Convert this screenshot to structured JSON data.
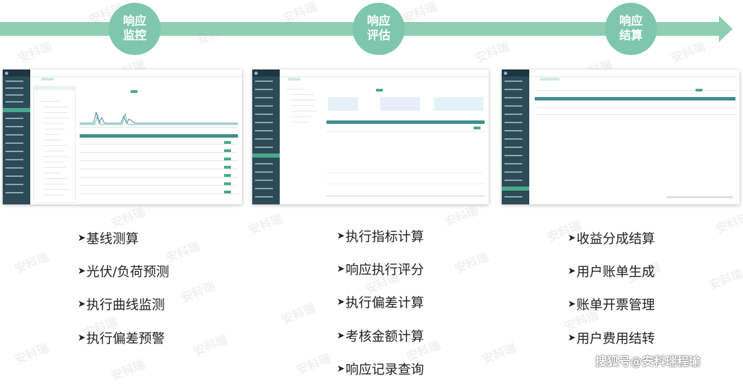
{
  "stages": [
    {
      "label_line1": "响应",
      "label_line2": "监控"
    },
    {
      "label_line1": "响应",
      "label_line2": "评估"
    },
    {
      "label_line1": "响应",
      "label_line2": "结算"
    }
  ],
  "lists": [
    [
      "基线测算",
      "光伏/负荷预测",
      "执行曲线监测",
      "执行偏差预警"
    ],
    [
      "执行指标计算",
      "响应执行评分",
      "执行偏差计算",
      "考核金额计算",
      "响应记录查询"
    ],
    [
      "收益分成结算",
      "用户账单生成",
      "账单开票管理",
      "用户费用结转"
    ]
  ],
  "watermark": "安科瑞",
  "credit": "搜狐号@安科瑞程瑜",
  "colors": {
    "band": "#8fcdb4",
    "stage": "#7ec7ae",
    "sidebar": "#2c4b57",
    "accent": "#49a98c"
  }
}
